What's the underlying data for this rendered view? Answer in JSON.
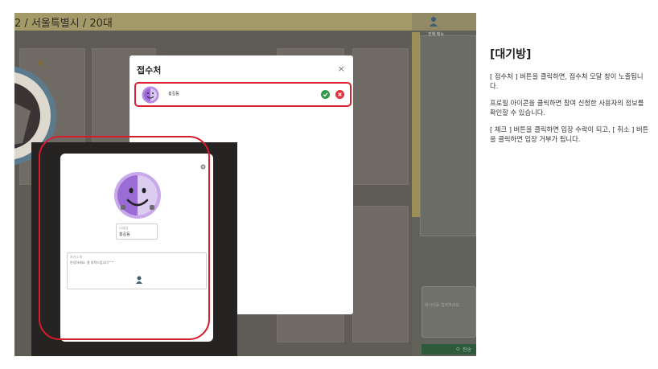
{
  "room": {
    "title": "2 / 서울특별시 / 20대"
  },
  "menu": {
    "label": "전체 메뉴",
    "icon": "people-icon"
  },
  "chat": {
    "placeholder": "메시지를 입력하세요",
    "send_label": "전송"
  },
  "modal": {
    "title": "접수처",
    "close_glyph": "×",
    "applicants": [
      {
        "name": "홍길동",
        "accept_icon": "check-circle-icon",
        "reject_icon": "x-circle-icon"
      }
    ]
  },
  "profile_popup": {
    "name_label": "닉네임",
    "name_value": "홍길동",
    "intro_label": "자기소개",
    "intro_text": "안녕하세요. 잘 부탁드립니다^^"
  },
  "description": {
    "title": "[대기방]",
    "paragraphs": [
      "[ 접수처 ] 버튼을 클릭하면, 접수처 모달 창이 노출됩니다.",
      "프로필 아이콘을 클릭하면 참여 신청한 사용자의 정보를 확인할 수 있습니다.",
      "[ 체크 ] 버튼을 클릭하면 입장 수락이 되고, [ 취소 ] 버튼을 클릭하면 입장 거부가 됩니다."
    ]
  },
  "colors": {
    "highlight": "#dd1f2f",
    "accept": "#2f9a4a",
    "reject": "#e0353f",
    "avatar_purple": "#9b6bd6"
  }
}
